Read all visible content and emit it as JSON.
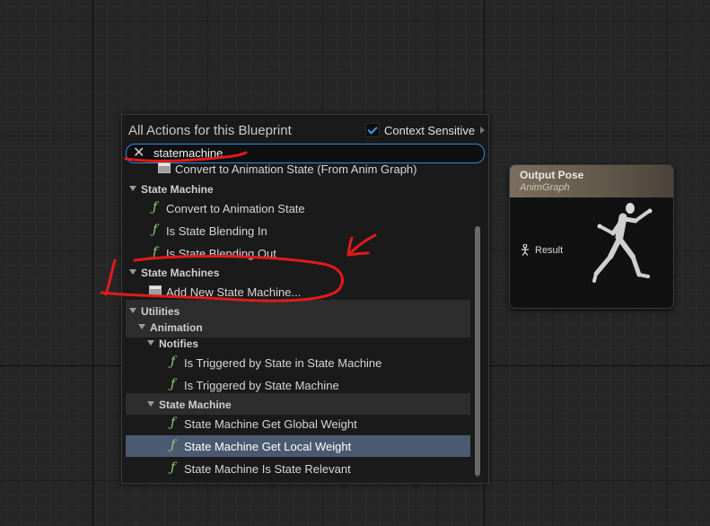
{
  "menu": {
    "title": "All Actions for this Blueprint",
    "context_label": "Context Sensitive",
    "context_checked": true,
    "search_value": "statemachine"
  },
  "list": [
    {
      "type": "node",
      "label": "Convert to Animation State (From Anim Graph)"
    },
    {
      "type": "category",
      "label": "State Machine"
    },
    {
      "type": "function",
      "label": "Convert to Animation State"
    },
    {
      "type": "function",
      "label": "Is State Blending In"
    },
    {
      "type": "function",
      "label": "Is State Blending Out"
    },
    {
      "type": "category",
      "label": "State Machines"
    },
    {
      "type": "node",
      "label": "Add New State Machine..."
    },
    {
      "type": "category",
      "label": "Utilities"
    },
    {
      "type": "category",
      "label": "Animation"
    },
    {
      "type": "category",
      "label": "Notifies"
    },
    {
      "type": "function",
      "label": "Is Triggered by State in State Machine"
    },
    {
      "type": "function",
      "label": "Is Triggered by State Machine"
    },
    {
      "type": "category",
      "label": "State Machine"
    },
    {
      "type": "function",
      "label": "State Machine Get Global Weight"
    },
    {
      "type": "function",
      "label": "State Machine Get Local Weight",
      "selected": true
    },
    {
      "type": "function",
      "label": "State Machine Is State Relevant"
    }
  ],
  "node": {
    "title": "Output Pose",
    "subtitle": "AnimGraph",
    "pin_label": "Result"
  },
  "icons": {
    "function": "function-icon",
    "node": "node-icon",
    "clear": "clear-search-icon",
    "expand": "expand-triangle-icon"
  },
  "colors": {
    "accent": "#2f8bd8",
    "selection": "#4b5a70",
    "function_icon": "#8fd17a",
    "annotation": "#e31a1a",
    "node_header": "#7b6e5c"
  }
}
